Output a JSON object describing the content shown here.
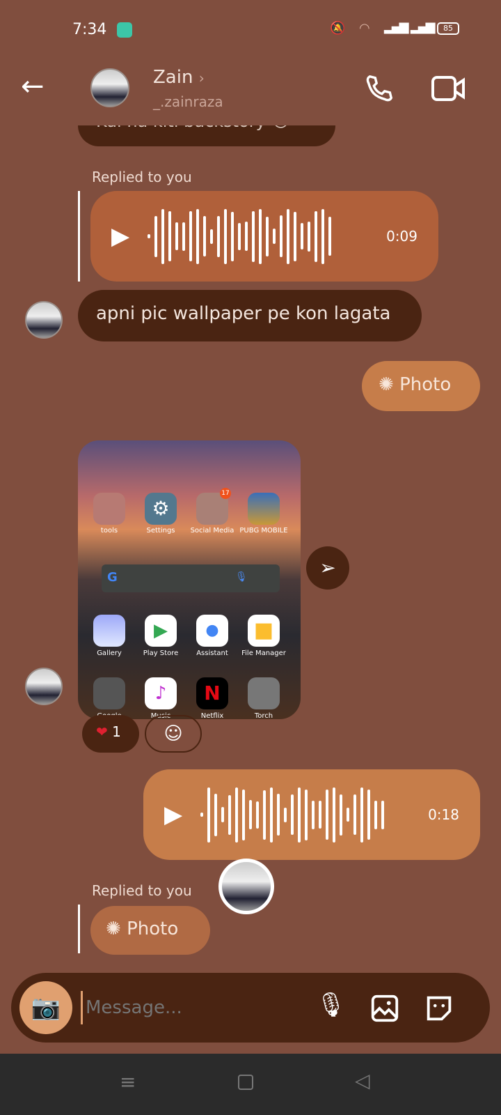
{
  "status": {
    "time": "7:34",
    "battery": "85"
  },
  "header": {
    "name": "Zain",
    "username": "_.zainraza"
  },
  "messages": {
    "top_partial": "Kal na kiti backstory 😭",
    "replied_label_1": "Replied to you",
    "voice_1_duration": "0:09",
    "text_1": "apni pic wallpaper pe kon lagata",
    "photo_label_1": "Photo",
    "screenshot": {
      "apps_row1": [
        "tools",
        "Settings",
        "Social Media",
        "PUBG MOBILE"
      ],
      "badge": "17",
      "apps_row2": [
        "Gallery",
        "Play Store",
        "Assistant",
        "File Manager"
      ],
      "apps_row3": [
        "Google",
        "Music",
        "Netflix",
        "Torch"
      ]
    },
    "reaction_count": "1",
    "voice_2_duration": "0:18",
    "replied_label_2": "Replied to you",
    "photo_label_2": "Photo"
  },
  "composer": {
    "placeholder": "Message..."
  }
}
